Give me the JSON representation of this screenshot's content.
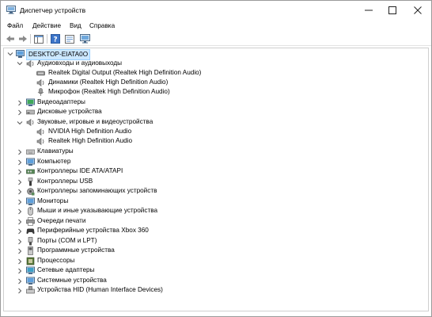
{
  "window": {
    "title": "Диспетчер устройств"
  },
  "menu": [
    "Файл",
    "Действие",
    "Вид",
    "Справка"
  ],
  "tree": {
    "root": "DESKTOP-EIATA0O",
    "groups": [
      {
        "label": "Аудиовходы и аудиовыходы",
        "expanded": true,
        "icon": "speaker-mic-icon",
        "children": [
          {
            "label": "Realtek Digital Output (Realtek High Definition Audio)",
            "icon": "digital-output-icon"
          },
          {
            "label": "Динамики (Realtek High Definition Audio)",
            "icon": "speaker-icon"
          },
          {
            "label": "Микрофон (Realtek High Definition Audio)",
            "icon": "microphone-icon"
          }
        ]
      },
      {
        "label": "Видеоадаптеры",
        "expanded": false,
        "icon": "display-adapter-icon"
      },
      {
        "label": "Дисковые устройства",
        "expanded": false,
        "icon": "disk-drive-icon"
      },
      {
        "label": "Звуковые, игровые и видеоустройства",
        "expanded": true,
        "icon": "sound-device-icon",
        "children": [
          {
            "label": "NVIDIA High Definition Audio",
            "icon": "speaker-icon"
          },
          {
            "label": "Realtek High Definition Audio",
            "icon": "speaker-icon"
          }
        ]
      },
      {
        "label": "Клавиатуры",
        "expanded": false,
        "icon": "keyboard-icon"
      },
      {
        "label": "Компьютер",
        "expanded": false,
        "icon": "computer-icon"
      },
      {
        "label": "Контроллеры IDE ATA/ATAPI",
        "expanded": false,
        "icon": "ide-controller-icon"
      },
      {
        "label": "Контроллеры USB",
        "expanded": false,
        "icon": "usb-icon"
      },
      {
        "label": "Контроллеры запоминающих устройств",
        "expanded": false,
        "icon": "storage-controller-icon"
      },
      {
        "label": "Мониторы",
        "expanded": false,
        "icon": "monitor-icon"
      },
      {
        "label": "Мыши и иные указывающие устройства",
        "expanded": false,
        "icon": "mouse-icon"
      },
      {
        "label": "Очереди печати",
        "expanded": false,
        "icon": "printer-icon"
      },
      {
        "label": "Периферийные устройства Xbox 360",
        "expanded": false,
        "icon": "gamepad-icon"
      },
      {
        "label": "Порты (COM и LPT)",
        "expanded": false,
        "icon": "port-icon"
      },
      {
        "label": "Программные устройства",
        "expanded": false,
        "icon": "software-device-icon"
      },
      {
        "label": "Процессоры",
        "expanded": false,
        "icon": "processor-icon"
      },
      {
        "label": "Сетевые адаптеры",
        "expanded": false,
        "icon": "network-adapter-icon"
      },
      {
        "label": "Системные устройства",
        "expanded": false,
        "icon": "system-device-icon"
      },
      {
        "label": "Устройства HID (Human Interface Devices)",
        "expanded": false,
        "icon": "hid-icon"
      }
    ]
  }
}
